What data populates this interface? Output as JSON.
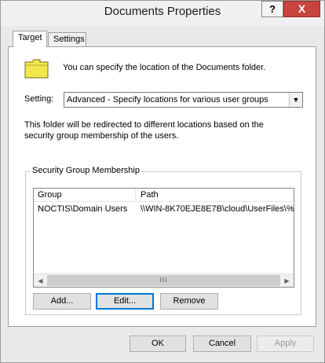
{
  "window": {
    "title": "Documents Properties",
    "help_label": "?",
    "close_label": "X"
  },
  "tabs": [
    {
      "label": "Target",
      "active": true
    },
    {
      "label": "Settings",
      "active": false
    }
  ],
  "target": {
    "info_text": "You can specify the location of the Documents folder.",
    "setting_label": "Setting:",
    "setting_value": "Advanced - Specify locations for various user groups",
    "description": "This folder will be redirected to different locations based on the security group membership of the users."
  },
  "group_membership": {
    "label": "Security Group Membership",
    "columns": [
      "Group",
      "Path"
    ],
    "rows": [
      {
        "group": "NOCTIS\\Domain Users",
        "path": "\\\\WIN-8K70EJE8E7B\\cloud\\UserFiles\\%"
      }
    ],
    "scroll_thumb_label": "III",
    "buttons": {
      "add": "Add...",
      "edit": "Edit...",
      "remove": "Remove"
    }
  },
  "footer": {
    "ok": "OK",
    "cancel": "Cancel",
    "apply": "Apply"
  },
  "icons": {
    "folder": "folder-icon",
    "dropdown": "chevron-down-icon",
    "scroll_left": "arrow-left-icon",
    "scroll_right": "arrow-right-icon"
  },
  "colors": {
    "close_button": "#c7443e",
    "folder": "#f2e84c",
    "focus_border": "#0078d7"
  }
}
